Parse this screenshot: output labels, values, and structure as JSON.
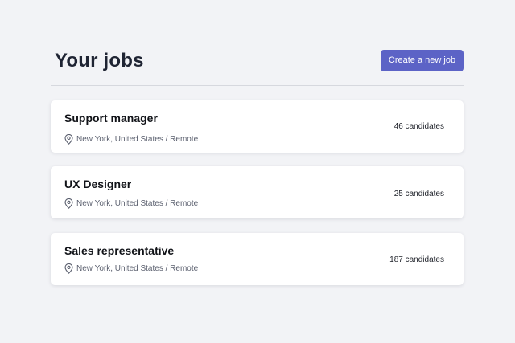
{
  "header": {
    "title": "Your jobs",
    "create_label": "Create a new job"
  },
  "jobs": [
    {
      "title": "Support manager",
      "location": "New York, United States / Remote",
      "candidates": "46 candidates"
    },
    {
      "title": "UX Designer",
      "location": "New York, United States / Remote",
      "candidates": "25 candidates"
    },
    {
      "title": "Sales representative",
      "location": "New York, United States / Remote",
      "candidates": "187 candidates"
    }
  ],
  "icons": {
    "location": "map-pin-icon"
  },
  "colors": {
    "background": "#f2f3f6",
    "accent": "#5c63c6",
    "card": "#ffffff",
    "title": "#1f2433"
  }
}
